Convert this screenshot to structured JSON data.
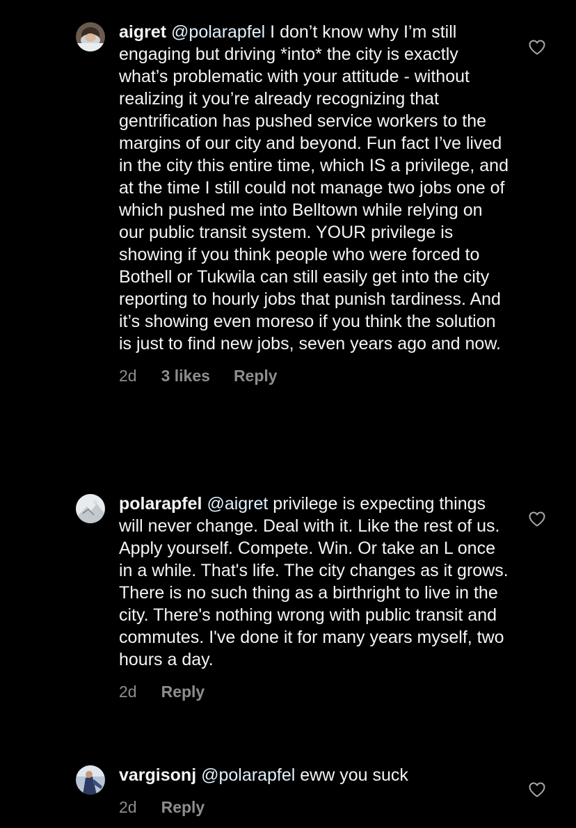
{
  "comments": [
    {
      "username": "aigret",
      "mention": "@polarapfel",
      "text": " I don’t know why I’m still engaging but driving *into* the city is exactly what’s problematic with your attitude - without realizing it you’re already recognizing that gentrification has pushed service workers to the margins of our city and beyond. Fun fact I’ve lived in the city this entire time, which IS a privilege, and at the time I still could not manage two jobs one of which pushed me into Belltown while relying on our public transit system. YOUR privilege is showing if you think people who were forced to Bothell or Tukwila can still easily get into the city reporting to hourly jobs that punish tardiness. And it’s showing even moreso if you think the solution is just to find new jobs, seven years ago and now.",
      "time": "2d",
      "likes": "3 likes",
      "reply": "Reply",
      "like_icon": "heart-outline-icon"
    },
    {
      "username": "polarapfel",
      "mention": "@aigret",
      "text": " privilege is expecting things will never change. Deal with it. Like the rest of us. Apply yourself. Compete. Win. Or take an L once in a while. That's life. The city changes as it grows. There is no such thing as a birthright to live in the city. There's nothing wrong with public transit and commutes. I've done it for many years myself, two hours a day.",
      "time": "2d",
      "reply": "Reply",
      "like_icon": "heart-outline-icon"
    },
    {
      "username": "vargisonj",
      "mention": "@polarapfel",
      "text": " eww you suck",
      "time": "2d",
      "reply": "Reply",
      "like_icon": "heart-outline-icon"
    }
  ],
  "colors": {
    "background": "#000000",
    "text": "#f5f5f5",
    "mention": "#e0f1ff",
    "meta": "#8e8e8e"
  }
}
